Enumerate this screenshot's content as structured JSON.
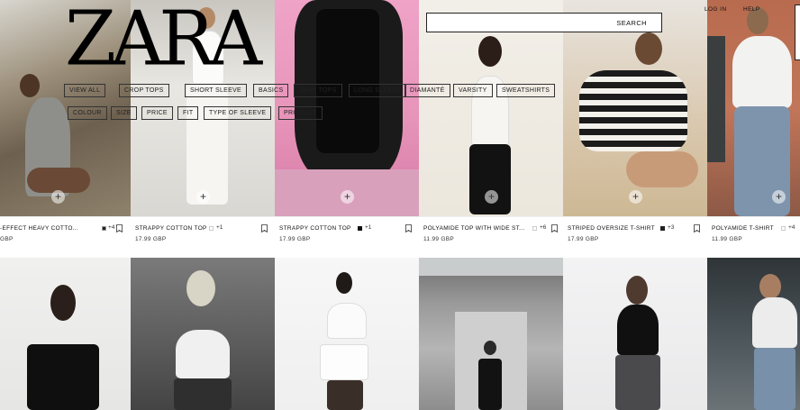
{
  "brand": {
    "logo": "ZARA"
  },
  "search": {
    "label": "SEARCH"
  },
  "top_links": {
    "login": "LOG IN",
    "help": "HELP"
  },
  "category_chips": [
    "VIEW ALL",
    "CROP TOPS",
    "SHORT SLEEVE",
    "BASICS",
    "TANK TOPS",
    "LONG SLEEVE",
    "DIAMANTÉ",
    "VARSITY",
    "SWEATSHIRTS"
  ],
  "filter_chips": [
    "COLOUR",
    "SIZE",
    "PRICE",
    "FIT",
    "TYPE OF SLEEVE",
    "PRODUCT"
  ],
  "products_row1": [
    {
      "name": "-EFFECT HEAVY COTTO...",
      "swatch": "#222222",
      "more": "+4",
      "price": "GBP"
    },
    {
      "name": "STRAPPY COTTON TOP",
      "swatch": "#ffffff",
      "more": "+1",
      "price": "17.99 GBP"
    },
    {
      "name": "STRAPPY COTTON TOP",
      "swatch": "#111111",
      "more": "+1",
      "price": "17.99 GBP"
    },
    {
      "name": "POLYAMIDE TOP WITH WIDE ST...",
      "swatch": "#ffffff",
      "more": "+6",
      "price": "11.99 GBP"
    },
    {
      "name": "STRIPED OVERSIZE T-SHIRT",
      "swatch": "#222222",
      "more": "+3",
      "price": "17.99 GBP"
    },
    {
      "name": "POLYAMIDE T-SHIRT",
      "swatch": "#ffffff",
      "more": "+4",
      "price": "11.99 GBP"
    }
  ],
  "colors": {
    "text": "#111111",
    "chip_border": "#333333"
  }
}
